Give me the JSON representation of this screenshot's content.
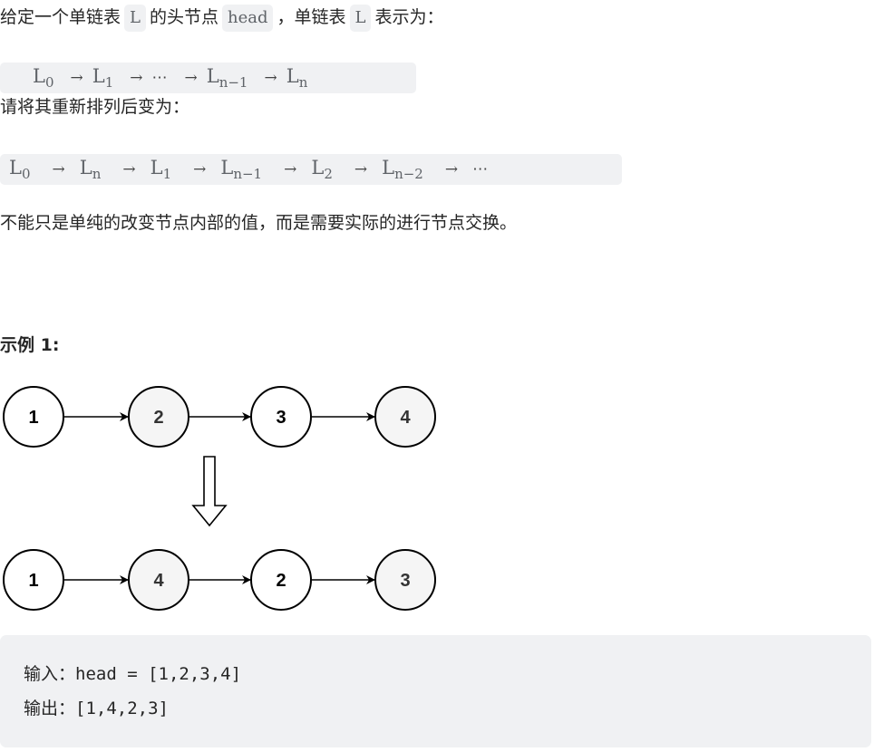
{
  "intro": {
    "p1": "给定一个单链表",
    "code_L": "L",
    "p2": "的头节点",
    "code_head": "head",
    "p3": "，单链表",
    "code_L2": "L",
    "p4": "表示为："
  },
  "formula1": {
    "terms": [
      {
        "base": "L",
        "sub": "0"
      },
      {
        "base": "L",
        "sub": "1"
      },
      {
        "base": "⋯",
        "sub": ""
      },
      {
        "base": "L",
        "sub": "n−1"
      },
      {
        "base": "L",
        "sub": "n"
      }
    ],
    "arrow": "→"
  },
  "rearrange_label": "请将其重新排列后变为：",
  "formula2": {
    "terms": [
      {
        "base": "L",
        "sub": "0"
      },
      {
        "base": "L",
        "sub": "n"
      },
      {
        "base": "L",
        "sub": "1"
      },
      {
        "base": "L",
        "sub": "n−1"
      },
      {
        "base": "L",
        "sub": "2"
      },
      {
        "base": "L",
        "sub": "n−2"
      }
    ],
    "arrow": "→",
    "ellipsis": "⋯"
  },
  "note": "不能只是单纯的改变节点内部的值，而是需要实际的进行节点交换。",
  "example_title": "示例 1:",
  "diagram": {
    "before": [
      {
        "value": "1",
        "shaded": false
      },
      {
        "value": "2",
        "shaded": true
      },
      {
        "value": "3",
        "shaded": false
      },
      {
        "value": "4",
        "shaded": true
      }
    ],
    "after": [
      {
        "value": "1",
        "shaded": false
      },
      {
        "value": "4",
        "shaded": true
      },
      {
        "value": "2",
        "shaded": false
      },
      {
        "value": "3",
        "shaded": true
      }
    ],
    "colors": {
      "shaded": "#f5f5f5",
      "plain": "#ffffff",
      "stroke": "#000000",
      "text_plain": "#000000",
      "text_shaded": "#333333"
    }
  },
  "example": {
    "input_label": "输入：",
    "input_value": "head = [1,2,3,4]",
    "output_label": "输出：",
    "output_value": "[1,4,2,3]"
  }
}
